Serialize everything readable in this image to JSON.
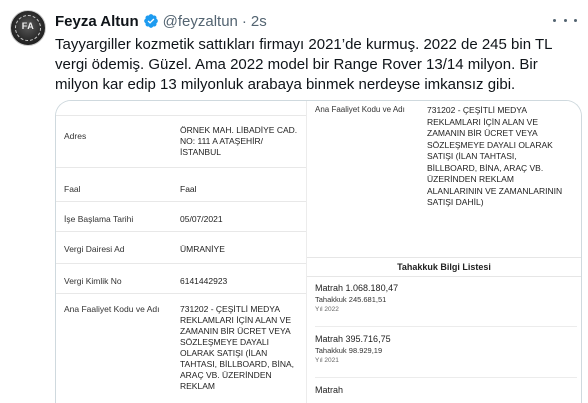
{
  "tweet": {
    "display_name": "Feyza Altun",
    "handle": "@feyzaltun",
    "separator": "·",
    "time": "2s",
    "avatar_text": "FA",
    "text": "Tayyargiller kozmetik sattıkları firmayı 2021’de kurmuş. 2022 de 245 bin TL vergi ödemiş. Güzel. Ama 2022 model bir Range Rover 13/14 milyon. Bir milyon kar edip 13 milyonluk arabaya binmek nerdeyse imkansız gibi."
  },
  "document": {
    "rows": [
      {
        "label": "Adres",
        "value": "ÖRNEK MAH. LİBADİYE CAD. NO: 111 A ATAŞEHİR/ İSTANBUL"
      },
      {
        "label": "Faal",
        "value": "Faal"
      },
      {
        "label": "İşe Başlama Tarihi",
        "value": "05/07/2021"
      },
      {
        "label": "Vergi Dairesi Ad",
        "value": "ÜMRANİYE"
      },
      {
        "label": "Vergi Kimlik No",
        "value": "6141442923"
      },
      {
        "label": "Ana Faaliyet Kodu ve Adı",
        "value": "731202 - ÇEŞİTLİ MEDYA REKLAMLARI İÇİN ALAN VE ZAMANIN BİR ÜCRET VEYA SÖZLEŞMEYE DAYALI OLARAK SATIŞI (İLAN TAHTASI, BİLLBOARD, BİNA, ARAÇ VB. ÜZERİNDEN REKLAM"
      }
    ],
    "right_top": {
      "label": "Ana Faaliyet Kodu ve Adı",
      "value": "731202 - ÇEŞİTLİ MEDYA REKLAMLARI İÇİN ALAN VE ZAMANIN BİR ÜCRET VEYA SÖZLEŞMEYE DAYALI OLARAK SATIŞI (İLAN TAHTASI, BİLLBOARD, BİNA, ARAÇ VB. ÜZERİNDEN REKLAM ALANLARININ VE ZAMANLARININ SATIŞI DAHİL)"
    },
    "tahakkuk_title": "Tahakkuk Bilgi Listesi",
    "tahakkuk": [
      {
        "matrah_label": "Matrah",
        "matrah": "1.068.180,47",
        "tahakkuk_label": "Tahakkuk",
        "tahakkuk": "245.681,51",
        "yil_label": "Yıl",
        "yil": "2022"
      },
      {
        "matrah_label": "Matrah",
        "matrah": "395.716,75",
        "tahakkuk_label": "Tahakkuk",
        "tahakkuk": "98.929,19",
        "yil_label": "Yıl",
        "yil": "2021"
      },
      {
        "matrah_label": "Matrah",
        "matrah": "",
        "tahakkuk_label": "",
        "tahakkuk": "",
        "yil_label": "",
        "yil": ""
      }
    ]
  },
  "colors": {
    "verified": "#1d9bf0",
    "secondary_text": "#536471",
    "border": "#cfd9de"
  },
  "icons": {
    "verified": "verified-badge-icon",
    "more": "more-dots-icon"
  }
}
